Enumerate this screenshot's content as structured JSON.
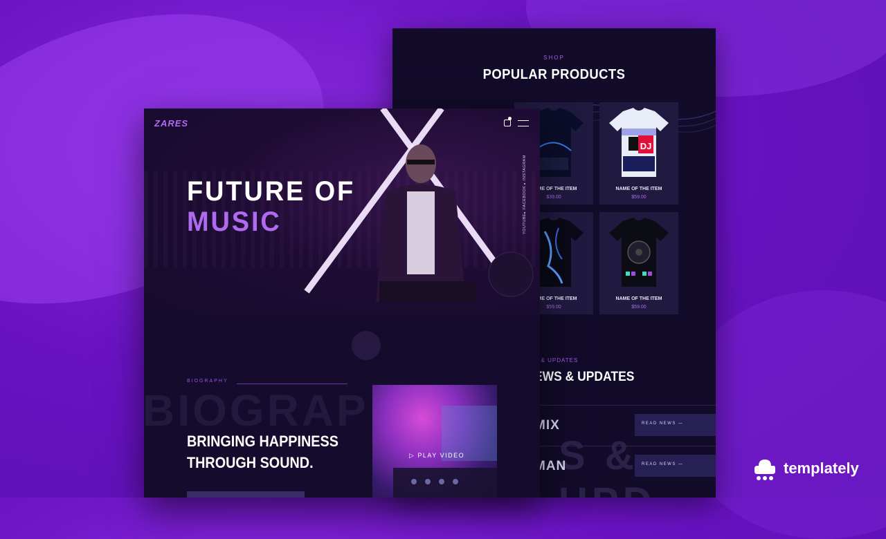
{
  "colors": {
    "accent": "#b06af0",
    "panel": "#150b2c",
    "background": "#6a12c4"
  },
  "shop": {
    "eyebrow": "SHOP",
    "title": "POPULAR PRODUCTS",
    "products": [
      {
        "name": "NAME OF THE ITEM",
        "price": "$39.00"
      },
      {
        "name": "NAME OF THE ITEM",
        "price": "$59.00"
      },
      {
        "name": "NAME OF THE ITEM",
        "price": "$59.00"
      },
      {
        "name": "NAME OF THE ITEM",
        "price": "$59.00"
      }
    ],
    "news_eyebrow": "S & UPDATES",
    "news_title": "EWS & UPDATES",
    "news_bg": "S & UPD",
    "news": [
      {
        "title": "MIX",
        "button": "READ NEWS —"
      },
      {
        "title": "MAN",
        "button": "READ NEWS —"
      }
    ]
  },
  "hero": {
    "logo": "ZARES",
    "headline_1": "FUTURE OF",
    "headline_2": "MUSIC",
    "social": [
      "INSTAGRAM",
      "FACEBOOK",
      "YOUTUBE"
    ],
    "icons": [
      "cart-icon",
      "menu-icon"
    ]
  },
  "bio": {
    "eyebrow": "BIOGRAPHY",
    "bg_text": "BIOGRAP",
    "title_1": "BRINGING HAPPINESS",
    "title_2": "THROUGH SOUND.",
    "video_label": "▷ PLAY VIDEO"
  },
  "brand": {
    "name": "templately"
  }
}
